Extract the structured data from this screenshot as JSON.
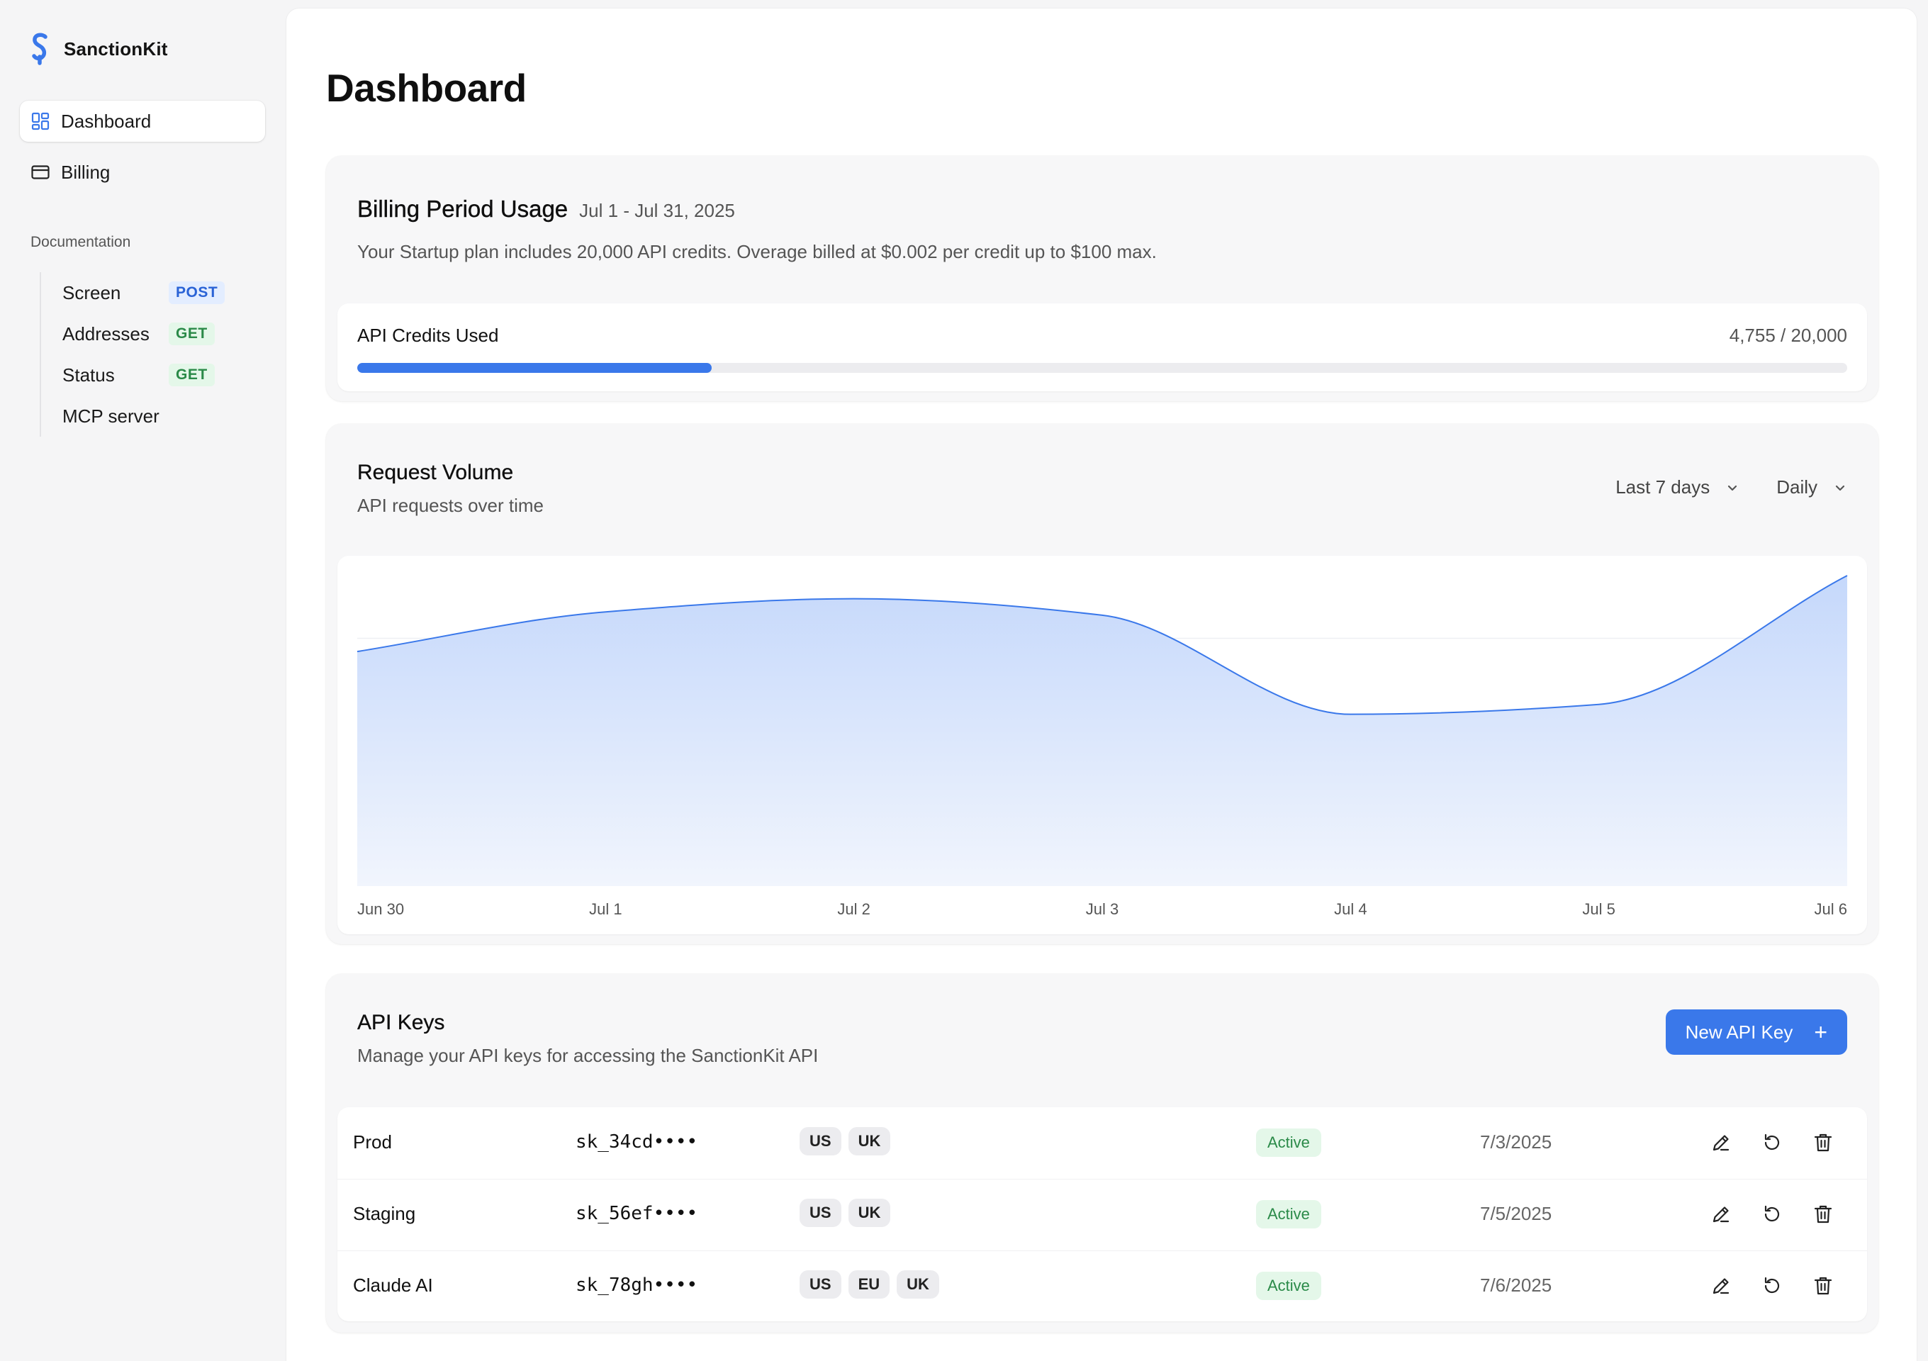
{
  "brand": {
    "name": "SanctionKit"
  },
  "sidebar": {
    "nav": [
      {
        "label": "Dashboard",
        "icon": "dashboard-grid-icon",
        "active": true
      },
      {
        "label": "Billing",
        "icon": "credit-card-icon",
        "active": false
      }
    ],
    "doc_heading": "Documentation",
    "docs": [
      {
        "label": "Screen",
        "method": "POST"
      },
      {
        "label": "Addresses",
        "method": "GET"
      },
      {
        "label": "Status",
        "method": "GET"
      },
      {
        "label": "MCP server",
        "method": ""
      }
    ]
  },
  "page": {
    "title": "Dashboard"
  },
  "billing": {
    "title": "Billing Period Usage",
    "period": "Jul 1 - Jul 31, 2025",
    "description": "Your Startup plan includes 20,000 API credits. Overage billed at $0.002 per credit up to $100 max.",
    "usage_label": "API Credits Used",
    "usage_count": "4,755 / 20,000",
    "used": 4755,
    "total": 20000
  },
  "volume": {
    "title": "Request Volume",
    "subtitle": "API requests over time",
    "range_label": "Last 7 days",
    "interval_label": "Daily"
  },
  "chart_data": {
    "type": "area",
    "title": "Request Volume",
    "x": [
      "Jun 30",
      "Jul 1",
      "Jul 2",
      "Jul 3",
      "Jul 4",
      "Jul 5",
      "Jul 6"
    ],
    "values": [
      0.71,
      0.83,
      0.87,
      0.82,
      0.52,
      0.55,
      0.94
    ],
    "ylim": [
      0,
      1
    ],
    "y_axis_visible": false,
    "grid": "horizontal",
    "color": "#3a78ea",
    "fill_top": "#c5d8fb",
    "fill_bottom": "#f1f5fd"
  },
  "keys": {
    "title": "API Keys",
    "subtitle": "Manage your API keys for accessing the SanctionKit API",
    "new_button": "New API Key",
    "rows": [
      {
        "name": "Prod",
        "token": "sk_34cd••••",
        "regions": [
          "US",
          "UK"
        ],
        "status": "Active",
        "date": "7/3/2025"
      },
      {
        "name": "Staging",
        "token": "sk_56ef••••",
        "regions": [
          "US",
          "UK"
        ],
        "status": "Active",
        "date": "7/5/2025"
      },
      {
        "name": "Claude AI",
        "token": "sk_78gh••••",
        "regions": [
          "US",
          "EU",
          "UK"
        ],
        "status": "Active",
        "date": "7/6/2025"
      }
    ]
  },
  "colors": {
    "accent": "#3a78ea",
    "status_active_bg": "#e4f7e9",
    "status_active_text": "#2a8a48",
    "post_bg": "#e3edff",
    "post_text": "#2a63d6"
  }
}
